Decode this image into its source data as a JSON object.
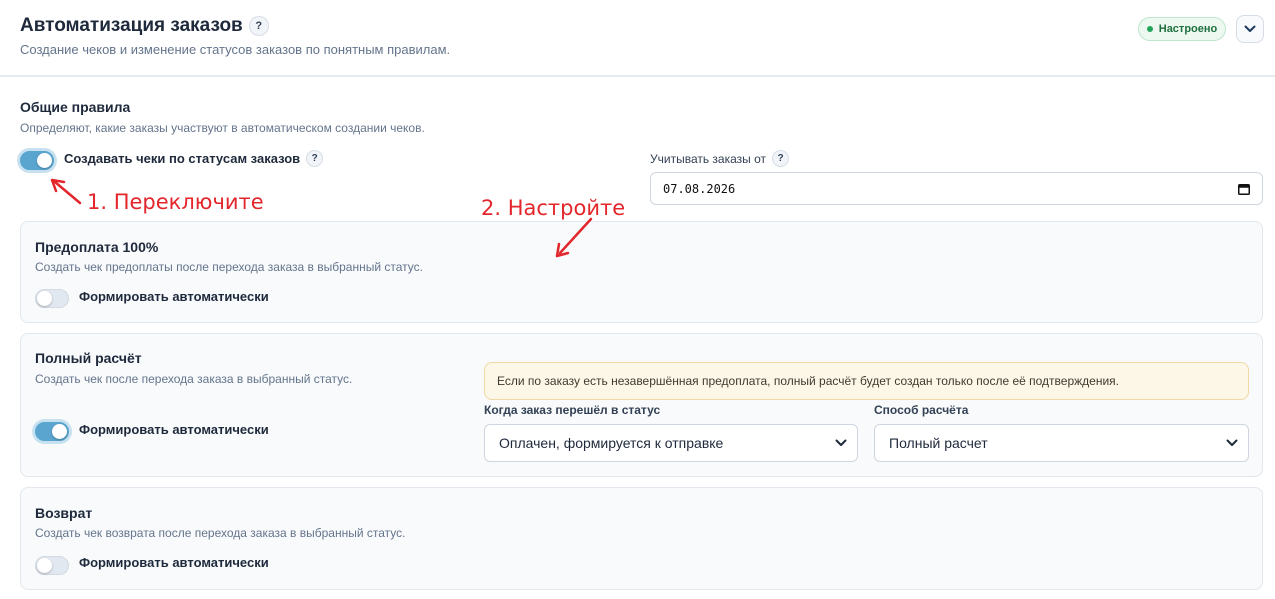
{
  "header": {
    "title": "Автоматизация заказов",
    "subtitle": "Создание чеков и изменение статусов заказов по понятным правилам.",
    "status_badge": "Настроено",
    "help_glyph": "?"
  },
  "general": {
    "title": "Общие правила",
    "description": "Определяют, какие заказы участвуют в автоматическом создании чеков.",
    "toggle_label": "Создавать чеки по статусам заказов",
    "toggle_on": true,
    "date_label": "Учитывать заказы от",
    "date_value": "07.08.2026"
  },
  "prepayment": {
    "title": "Предоплата 100%",
    "description": "Создать чек предоплаты после перехода заказа в выбранный статус.",
    "toggle_label": "Формировать автоматически",
    "toggle_on": false
  },
  "full_payment": {
    "title": "Полный расчёт",
    "description": "Создать чек после перехода заказа в выбранный статус.",
    "toggle_label": "Формировать автоматически",
    "toggle_on": true,
    "alert": "Если по заказу есть незавершённая предоплата, полный расчёт будет создан только после её подтверждения.",
    "status_label": "Когда заказ перешёл в статус",
    "status_value": "Оплачен, формируется к отправке",
    "method_label": "Способ расчёта",
    "method_value": "Полный расчет"
  },
  "refund": {
    "title": "Возврат",
    "description": "Создать чек возврата после перехода заказа в выбранный статус.",
    "toggle_label": "Формировать автоматически",
    "toggle_on": false
  },
  "annotations": {
    "step1": "1. Переключите",
    "step2": "2. Настройте",
    "color": "#e3262b"
  },
  "colors": {
    "toggle_on": "#5aa5cf",
    "badge_green": "#22a559"
  }
}
